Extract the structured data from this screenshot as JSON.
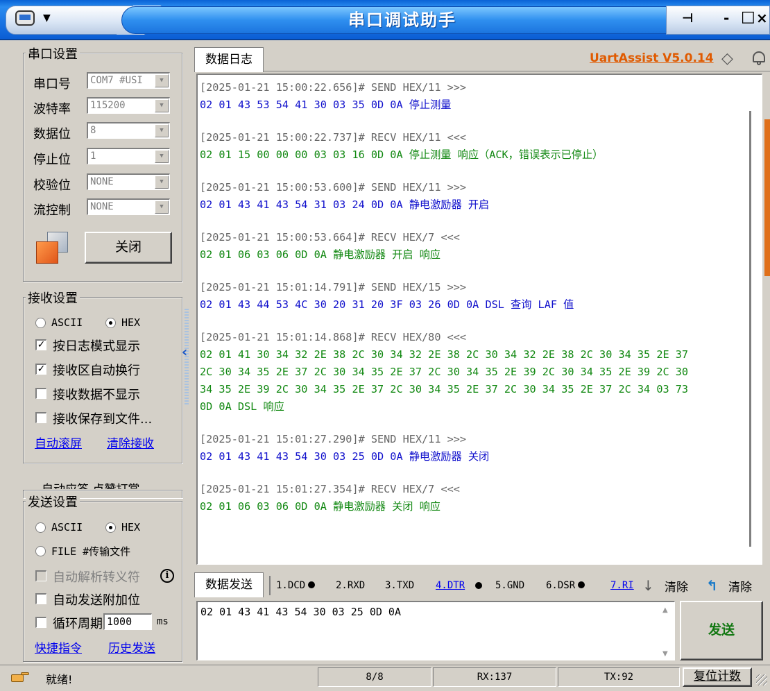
{
  "window": {
    "title": "串口调试助手",
    "menu_arrow": "▼",
    "pin": "⊣",
    "minimize": "-",
    "maximize": "□",
    "close": "×"
  },
  "serial_settings": {
    "title": "串口设置",
    "fields": [
      {
        "label": "串口号",
        "value": "COM7 #USI"
      },
      {
        "label": "波特率",
        "value": "115200"
      },
      {
        "label": "数据位",
        "value": "8"
      },
      {
        "label": "停止位",
        "value": "1"
      },
      {
        "label": "校验位",
        "value": "NONE"
      },
      {
        "label": "流控制",
        "value": "NONE"
      }
    ],
    "close_button": "关闭"
  },
  "receive_settings": {
    "title": "接收设置",
    "ascii": "ASCII",
    "hex": "HEX",
    "options": [
      {
        "label": "按日志模式显示",
        "checked": "✓"
      },
      {
        "label": "接收区自动换行",
        "checked": "✓"
      },
      {
        "label": "接收数据不显示",
        "checked": ""
      },
      {
        "label": "接收保存到文件...",
        "checked": ""
      }
    ],
    "link_autoscroll": "自动滚屏",
    "link_clear": "清除接收"
  },
  "hidden_group_title": "自动应答  点赞打赏",
  "send_settings": {
    "title": "发送设置",
    "ascii": "ASCII",
    "hex": "HEX",
    "file": "FILE #传输文件",
    "options": [
      {
        "label": "自动解析转义符",
        "checked": ""
      },
      {
        "label": "自动发送附加位",
        "checked": ""
      },
      {
        "label": "循环周期",
        "checked": ""
      }
    ],
    "info_icon": "i",
    "period_value": "1000",
    "period_unit": "ms",
    "link_shortcut": "快捷指令",
    "link_history": "历史发送"
  },
  "log_tab": {
    "label": "数据日志",
    "brand": "UartAssist V5.0.14"
  },
  "log_entries": [
    {
      "header": "[2025-01-21 15:00:22.656]# SEND HEX/11 >>>",
      "dir": "send",
      "lines": [
        "02 01 43 53 54 41 30 03 35 0D 0A 停止测量"
      ]
    },
    {
      "header": "[2025-01-21 15:00:22.737]# RECV HEX/11 <<<",
      "dir": "recv",
      "lines": [
        "02 01 15 00 00 00 03 03 16 0D 0A 停止测量 响应（ACK，错误表示已停止）"
      ]
    },
    {
      "header": "[2025-01-21 15:00:53.600]# SEND HEX/11 >>>",
      "dir": "send",
      "lines": [
        "02 01 43 41 43 54 31 03 24 0D 0A 静电激励器 开启"
      ]
    },
    {
      "header": "[2025-01-21 15:00:53.664]# RECV HEX/7 <<<",
      "dir": "recv",
      "lines": [
        "02 01 06 03 06 0D 0A 静电激励器 开启 响应"
      ]
    },
    {
      "header": "[2025-01-21 15:01:14.791]# SEND HEX/15 >>>",
      "dir": "send",
      "lines": [
        "02 01 43 44 53 4C 30 20 31 20 3F 03 26 0D 0A DSL 查询 LAF 值"
      ]
    },
    {
      "header": "[2025-01-21 15:01:14.868]# RECV HEX/80 <<<",
      "dir": "recv",
      "lines": [
        "02 01 41 30 34 32 2E 38 2C 30 34 32 2E 38 2C 30 34 32 2E 38 2C 30 34 35 2E 37",
        "2C 30 34 35 2E 37 2C 30 34 35 2E 37 2C 30 34 35 2E 39 2C 30 34 35 2E 39 2C 30",
        "34 35 2E 39 2C 30 34 35 2E 37 2C 30 34 35 2E 37 2C 30 34 35 2E 37 2C 34 03 73",
        "0D 0A DSL 响应"
      ]
    },
    {
      "header": "[2025-01-21 15:01:27.290]# SEND HEX/11 >>>",
      "dir": "send",
      "lines": [
        "02 01 43 41 43 54 30 03 25 0D 0A 静电激励器 关闭"
      ]
    },
    {
      "header": "[2025-01-21 15:01:27.354]# RECV HEX/7 <<<",
      "dir": "recv",
      "lines": [
        "02 01 06 03 06 0D 0A 静电激励器 关闭 响应"
      ]
    }
  ],
  "send_tab": {
    "label": "数据发送",
    "signals": {
      "dcd": "1.DCD",
      "rxd": "2.RXD",
      "txd": "3.TXD",
      "dtr": "4.DTR",
      "gnd": "5.GND",
      "dsr": "6.DSR",
      "ri": "7.RI"
    },
    "clear1": "清除",
    "clear2": "清除"
  },
  "send_input": "02 01 43 41 43 54 30 03 25 0D 0A",
  "send_button": "发送",
  "status": {
    "ready": "就绪!",
    "count": "8/8",
    "rx": "RX:137",
    "tx": "TX:92",
    "reset": "复位计数"
  }
}
